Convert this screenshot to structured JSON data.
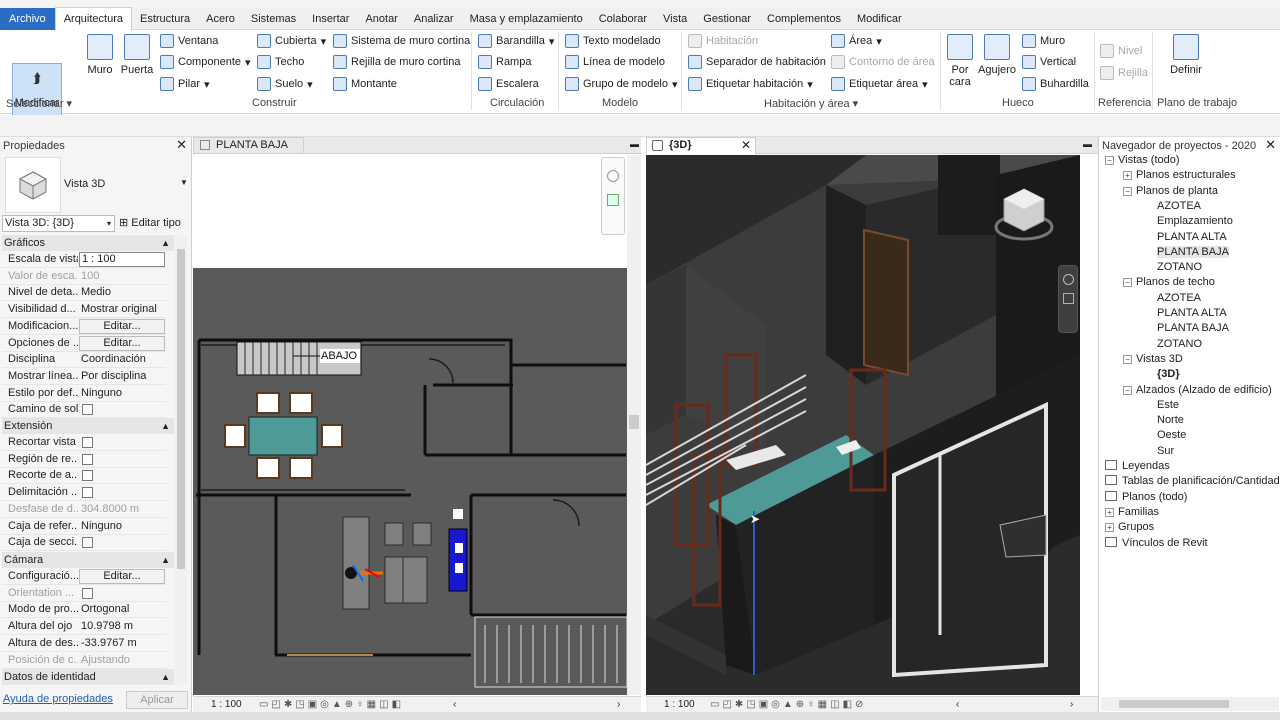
{
  "menu": {
    "tabs": [
      "Archivo",
      "Arquitectura",
      "Estructura",
      "Acero",
      "Sistemas",
      "Insertar",
      "Anotar",
      "Analizar",
      "Masa y emplazamiento",
      "Colaborar",
      "Vista",
      "Gestionar",
      "Complementos",
      "Modificar"
    ],
    "active": "Arquitectura"
  },
  "ribbon": {
    "seleccionar": {
      "modify_label": "Modificar",
      "panel": "Seleccionar"
    },
    "construir": {
      "panel": "Construir",
      "muro": "Muro",
      "puerta": "Puerta",
      "ventana": "Ventana",
      "componente": "Componente",
      "pilar": "Pilar",
      "cubierta": "Cubierta",
      "techo": "Techo",
      "suelo": "Suelo",
      "sistema_muro": "Sistema de muro cortina",
      "rejilla_muro": "Rejilla de muro cortina",
      "montante": "Montante"
    },
    "circulacion": {
      "panel": "Circulación",
      "barandilla": "Barandilla",
      "rampa": "Rampa",
      "escalera": "Escalera"
    },
    "modelo": {
      "panel": "Modelo",
      "texto": "Texto modelado",
      "linea": "Línea de modelo",
      "grupo": "Grupo de modelo"
    },
    "habitacion": {
      "panel": "Habitación y área",
      "habitacion": "Habitación",
      "separador": "Separador de habitación",
      "etiquetar_hab": "Etiquetar habitación",
      "area": "Área",
      "contorno": "Contorno de área",
      "etiquetar_area": "Etiquetar área"
    },
    "hueco": {
      "panel": "Hueco",
      "por_cara": "Por cara",
      "agujero": "Agujero",
      "muro": "Muro",
      "vertical": "Vertical",
      "buhardilla": "Buhardilla"
    },
    "referencia": {
      "panel": "Referencia",
      "nivel": "Nivel",
      "rejilla": "Rejilla"
    },
    "plano": {
      "panel": "Plano de trabajo",
      "definir": "Definir"
    }
  },
  "properties": {
    "title": "Propiedades",
    "type_name": "Vista 3D",
    "selector": "Vista 3D: {3D}",
    "edit_type": "Editar tipo",
    "sections": {
      "graficos": "Gráficos",
      "extension": "Extensión",
      "camara": "Cámara",
      "identidad": "Datos de identidad"
    },
    "graficos_rows": [
      {
        "k": "Escala de vista",
        "v": "1 : 100"
      },
      {
        "k": "Valor de esca...",
        "v": "100"
      },
      {
        "k": "Nivel de deta...",
        "v": "Medio"
      },
      {
        "k": "Visibilidad d...",
        "v": "Mostrar original"
      },
      {
        "k": "Modificacion...",
        "v": "Editar..."
      },
      {
        "k": "Opciones de ...",
        "v": "Editar..."
      },
      {
        "k": "Disciplina",
        "v": "Coordinación"
      },
      {
        "k": "Mostrar línea...",
        "v": "Por disciplina"
      },
      {
        "k": "Estilo por def...",
        "v": "Ninguno"
      },
      {
        "k": "Camino de sol",
        "v": ""
      }
    ],
    "extension_rows": [
      {
        "k": "Recortar vista",
        "v": ""
      },
      {
        "k": "Región de re...",
        "v": ""
      },
      {
        "k": "Recorte de a...",
        "v": ""
      },
      {
        "k": "Delimitación ...",
        "v": ""
      },
      {
        "k": "Desfase de d...",
        "v": "304.8000 m"
      },
      {
        "k": "Caja de refer...",
        "v": "Ninguno"
      },
      {
        "k": "Caja de secci...",
        "v": ""
      }
    ],
    "camara_rows": [
      {
        "k": "Configuració...",
        "v": "Editar..."
      },
      {
        "k": "Orientation ...",
        "v": ""
      },
      {
        "k": "Modo de pro...",
        "v": "Ortogonal"
      },
      {
        "k": "Altura del ojo",
        "v": "10.9798 m"
      },
      {
        "k": "Altura de des...",
        "v": "-33.9767 m"
      },
      {
        "k": "Posición de c...",
        "v": "Ajustando"
      }
    ],
    "help_link": "Ayuda de propiedades",
    "apply": "Aplicar"
  },
  "views": {
    "plan_tab": "PLANTA BAJA",
    "threed_tab": "{3D}",
    "plan_label": "ABAJO",
    "plan_scale": "1 : 100",
    "threed_scale": "1 : 100"
  },
  "browser": {
    "title": "Navegador de proyectos - 2020",
    "items": [
      {
        "label": "Vistas (todo)",
        "lvl": 0,
        "tog": "-"
      },
      {
        "label": "Planos estructurales",
        "lvl": 1,
        "tog": "+"
      },
      {
        "label": "Planos de planta",
        "lvl": 1,
        "tog": "-"
      },
      {
        "label": "AZOTEA",
        "lvl": 2,
        "tog": ""
      },
      {
        "label": "Emplazamiento",
        "lvl": 2,
        "tog": ""
      },
      {
        "label": "PLANTA ALTA",
        "lvl": 2,
        "tog": ""
      },
      {
        "label": "PLANTA BAJA",
        "lvl": 2,
        "tog": ""
      },
      {
        "label": "ZOTANO",
        "lvl": 2,
        "tog": ""
      },
      {
        "label": "Planos de techo",
        "lvl": 1,
        "tog": "-"
      },
      {
        "label": "AZOTEA",
        "lvl": 2,
        "tog": ""
      },
      {
        "label": "PLANTA ALTA",
        "lvl": 2,
        "tog": ""
      },
      {
        "label": "PLANTA BAJA",
        "lvl": 2,
        "tog": ""
      },
      {
        "label": "ZOTANO",
        "lvl": 2,
        "tog": ""
      },
      {
        "label": "Vistas 3D",
        "lvl": 1,
        "tog": "-"
      },
      {
        "label": "{3D}",
        "lvl": 2,
        "tog": ""
      },
      {
        "label": "Alzados (Alzado de edificio)",
        "lvl": 1,
        "tog": "-"
      },
      {
        "label": "Este",
        "lvl": 2,
        "tog": ""
      },
      {
        "label": "Norte",
        "lvl": 2,
        "tog": ""
      },
      {
        "label": "Oeste",
        "lvl": 2,
        "tog": ""
      },
      {
        "label": "Sur",
        "lvl": 2,
        "tog": ""
      },
      {
        "label": "Leyendas",
        "lvl": 0,
        "tog": ""
      },
      {
        "label": "Tablas de planificación/Cantidades",
        "lvl": 0,
        "tog": ""
      },
      {
        "label": "Planos (todo)",
        "lvl": 0,
        "tog": ""
      },
      {
        "label": "Familias",
        "lvl": 0,
        "tog": "+"
      },
      {
        "label": "Grupos",
        "lvl": 0,
        "tog": "+"
      },
      {
        "label": "Vínculos de Revit",
        "lvl": 0,
        "tog": ""
      }
    ]
  }
}
